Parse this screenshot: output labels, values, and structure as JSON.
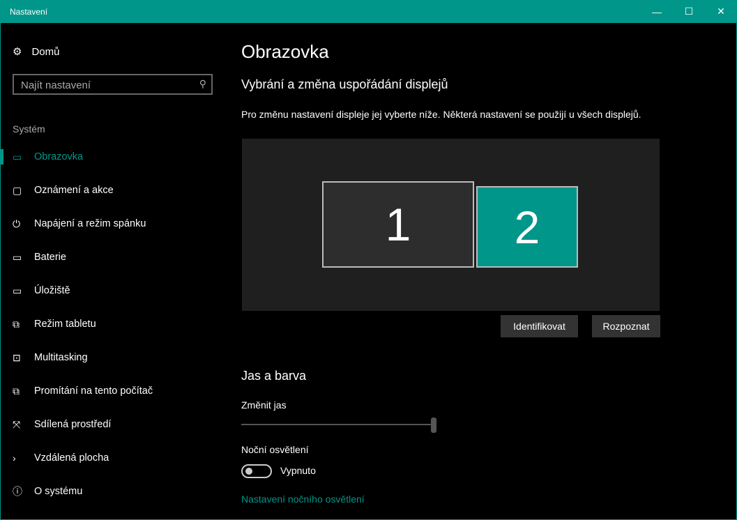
{
  "window": {
    "title": "Nastavení",
    "minimize": "—",
    "maximize": "☐",
    "close": "✕"
  },
  "sidebar": {
    "home": "Domů",
    "search_placeholder": "Najít nastavení",
    "section": "Systém",
    "items": [
      {
        "label": "Obrazovka",
        "icon": "▭"
      },
      {
        "label": "Oznámení a akce",
        "icon": "▢"
      },
      {
        "label": "Napájení a režim spánku",
        "icon": "⏻"
      },
      {
        "label": "Baterie",
        "icon": "▭"
      },
      {
        "label": "Úložiště",
        "icon": "▭"
      },
      {
        "label": "Režim tabletu",
        "icon": "⧉"
      },
      {
        "label": "Multitasking",
        "icon": "⊡"
      },
      {
        "label": "Promítání na tento počítač",
        "icon": "⧉"
      },
      {
        "label": "Sdílená prostředí",
        "icon": "⤧"
      },
      {
        "label": "Vzdálená plocha",
        "icon": "›"
      },
      {
        "label": "O systému",
        "icon": "ⓘ"
      }
    ]
  },
  "main": {
    "title": "Obrazovka",
    "subtitle": "Vybrání a změna uspořádání displejů",
    "description": "Pro změnu nastavení displeje jej vyberte níže. Některá nastavení se použijí u všech displejů.",
    "monitors": [
      "1",
      "2"
    ],
    "identify": "Identifikovat",
    "detect": "Rozpoznat",
    "section2": "Jas a barva",
    "brightness_label": "Změnit jas",
    "brightness_value": 100,
    "night_label": "Noční osvětlení",
    "night_state": "Vypnuto",
    "night_link": "Nastavení nočního osvětlení"
  },
  "colors": {
    "accent": "#00968a"
  }
}
